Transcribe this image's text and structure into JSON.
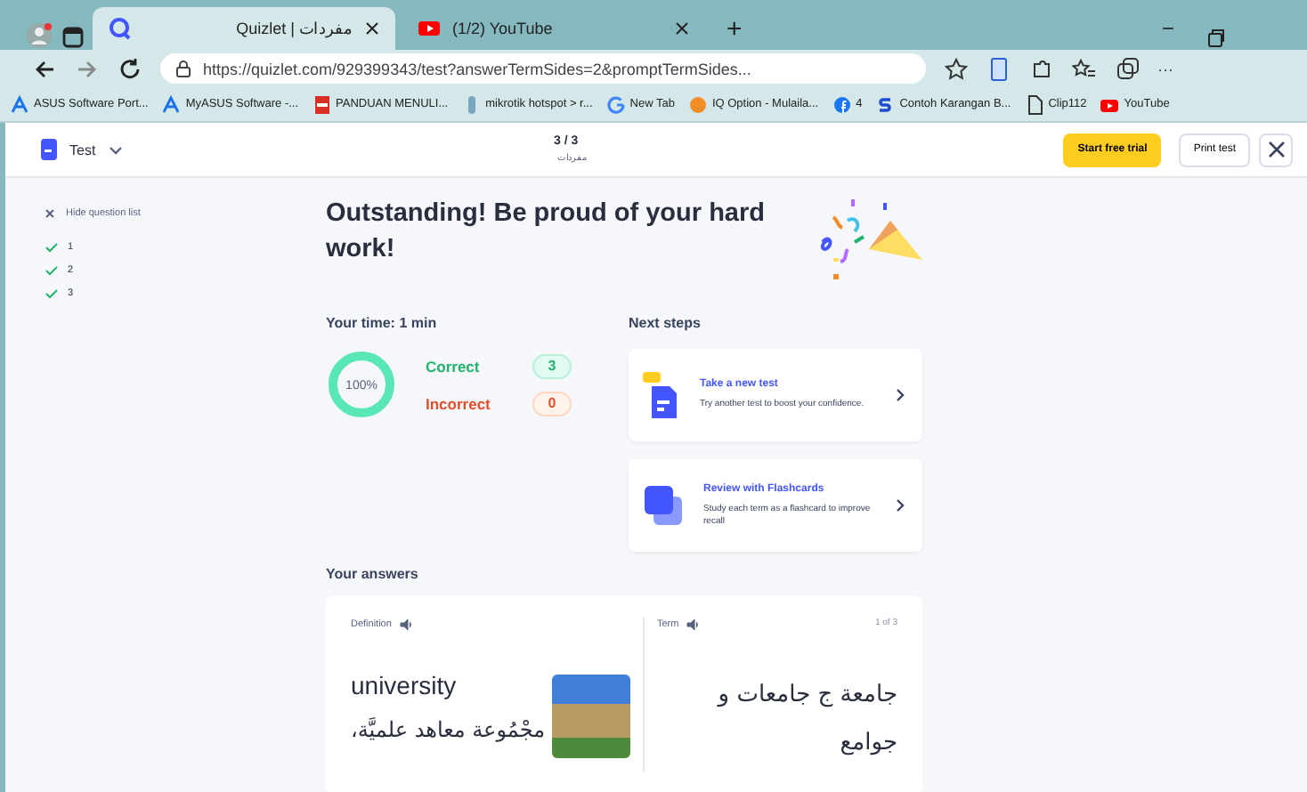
{
  "browser": {
    "tabs": [
      {
        "title": "Quizlet | مفردات",
        "selected": true,
        "kind": "quizlet"
      },
      {
        "title": "(1/2) YouTube",
        "selected": false,
        "kind": "youtube"
      }
    ],
    "new_tab": "+",
    "minimize": "−",
    "url": "https://quizlet.com/929399343/test?answerTermSides=2&promptTermSides...",
    "more": "···",
    "bookmarks": [
      {
        "label": "ASUS Software Port...",
        "kind": "asus"
      },
      {
        "label": "MyASUS Software -...",
        "kind": "asus"
      },
      {
        "label": "PANDUAN MENULI...",
        "kind": "pdf"
      },
      {
        "label": "mikrotik hotspot > r...",
        "kind": "mikrotik"
      },
      {
        "label": "New Tab",
        "kind": "google"
      },
      {
        "label": "IQ Option - Mulaila...",
        "kind": "iq"
      },
      {
        "label": "4",
        "kind": "facebook"
      },
      {
        "label": "Contoh Karangan B...",
        "kind": "s"
      },
      {
        "label": "Clip112",
        "kind": "page"
      },
      {
        "label": "YouTube",
        "kind": "youtube"
      }
    ]
  },
  "header": {
    "mode": "Test",
    "progress": "3 / 3",
    "set_title": "مفردات",
    "start_trial": "Start free trial",
    "print": "Print test"
  },
  "sidebar": {
    "hide_label": "Hide question list",
    "questions": [
      {
        "label": "1",
        "correct": true
      },
      {
        "label": "2",
        "correct": true
      },
      {
        "label": "3",
        "correct": true
      }
    ]
  },
  "headline": "Outstanding! Be proud of your hard work!",
  "results": {
    "time": "Your time: 1 min",
    "percent": "100%",
    "level": 1,
    "correct_label": "Correct",
    "correct_count": "3",
    "incorrect_label": "Incorrect",
    "incorrect_count": "0"
  },
  "next_steps": {
    "title": "Next steps",
    "cards": [
      {
        "kind": "test",
        "title": "Take a new test",
        "text": "Try another test to boost your confidence."
      },
      {
        "kind": "flashcards",
        "title": "Review with Flashcards",
        "text": "Study each term as a flashcard to improve recall"
      }
    ]
  },
  "answers": {
    "title": "Your answers",
    "definition_label": "Definition",
    "term_label": "Term",
    "counter": "1 of 3",
    "definition": "university",
    "definition_arabic": "مجْمُوعة معاهد علميَّة،",
    "term": "جامعة ج جامعات و جوامع"
  }
}
